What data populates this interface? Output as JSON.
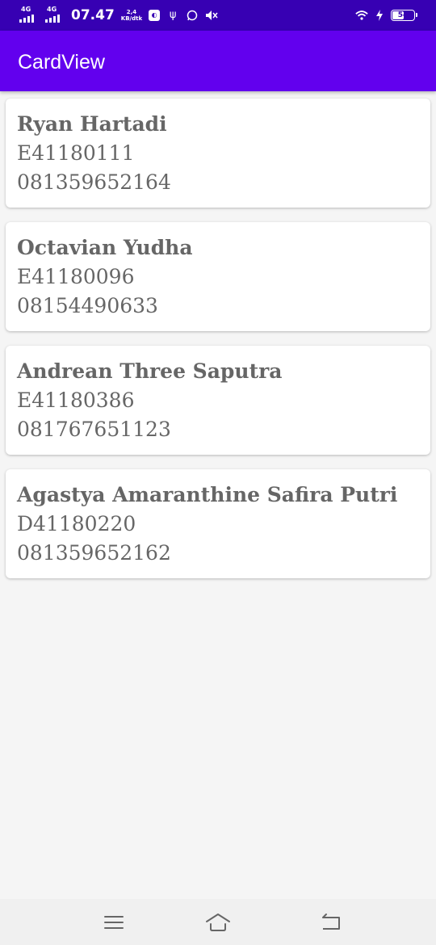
{
  "status_bar": {
    "network_1": "4G",
    "network_2": "4G",
    "time": "07.47",
    "speed_value": "2,4",
    "speed_unit": "KB/dtk",
    "battery_level": "54",
    "battery_fraction": 0.54,
    "icons": [
      "data-saver-icon",
      "usb-icon",
      "whatsapp-icon",
      "mute-icon",
      "wifi-icon",
      "charging-icon",
      "battery-icon"
    ]
  },
  "app_bar": {
    "title": "CardView"
  },
  "cards": [
    {
      "name": "Ryan Hartadi",
      "id": "E41180111",
      "phone": "081359652164"
    },
    {
      "name": "Octavian Yudha",
      "id": "E41180096",
      "phone": "08154490633"
    },
    {
      "name": "Andrean Three Saputra",
      "id": "E41180386",
      "phone": "081767651123"
    },
    {
      "name": "Agastya Amaranthine Safira Putri",
      "id": "D41180220",
      "phone": "081359652162"
    }
  ],
  "nav_bar": {
    "icons": [
      "menu-icon",
      "home-icon",
      "back-icon"
    ]
  },
  "colors": {
    "status_bar": "#3700b3",
    "app_bar": "#6200ee",
    "card_text": "#666666",
    "background": "#f5f5f5"
  }
}
